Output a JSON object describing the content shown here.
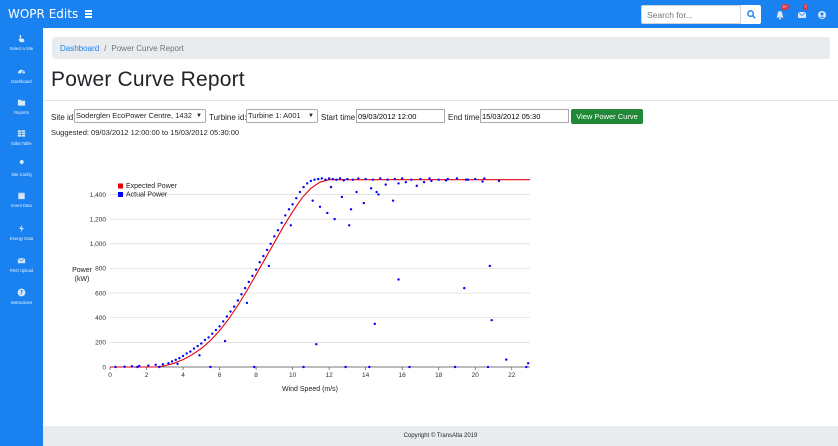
{
  "app": {
    "title": "WOPR Edits"
  },
  "topbar": {
    "search_placeholder": "Search for...",
    "alerts_badge": "9+",
    "messages_badge": "7"
  },
  "sidebar": {
    "items": [
      {
        "label": "Select a Site",
        "icon": "hand-pointer-icon"
      },
      {
        "label": "Dashboard",
        "icon": "gauge-icon"
      },
      {
        "label": "Reports",
        "icon": "folder-icon"
      },
      {
        "label": "Edits Table",
        "icon": "table-icon"
      },
      {
        "label": "Site Config",
        "icon": "wrench-icon"
      },
      {
        "label": "Event Data",
        "icon": "calendar-icon"
      },
      {
        "label": "Energy Data",
        "icon": "bolt-icon"
      },
      {
        "label": "RSO Upload",
        "icon": "envelope-icon"
      },
      {
        "label": "Instructions",
        "icon": "question-icon"
      }
    ]
  },
  "breadcrumb": {
    "home": "Dashboard",
    "separator": "/",
    "current": "Power Curve Report"
  },
  "page": {
    "title": "Power Curve Report"
  },
  "form": {
    "site_label": "Site id:",
    "site_value": "Soderglen EcoPower Centre, 1432",
    "turbine_label": "Turbine id:",
    "turbine_value": "Turbine 1: A001",
    "start_label": "Start time:",
    "start_value": "09/03/2012 12:00",
    "end_label": "End time:",
    "end_value": "15/03/2012 05:30",
    "submit_label": "View Power Curve",
    "suggested": "Suggested: 09/03/2012 12:00:00 to 15/03/2012 05:30:00"
  },
  "footer": {
    "copyright": "Copyright © TransAlta 2019"
  },
  "colors": {
    "primary": "#1a82f0",
    "expected": "#e8000b",
    "actual": "#0000ff",
    "success": "#218838"
  },
  "chart_data": {
    "type": "scatter",
    "title": "",
    "xlabel": "Wind Speed (m/s)",
    "ylabel": "Power\n(kW)",
    "xlim": [
      0,
      23
    ],
    "ylim": [
      0,
      1550
    ],
    "x_ticks": [
      0,
      2,
      4,
      6,
      8,
      10,
      12,
      14,
      16,
      18,
      20,
      22
    ],
    "y_ticks": [
      0,
      200,
      400,
      600,
      800,
      1000,
      1200,
      1400
    ],
    "y_tick_labels": [
      "0",
      "200",
      "400",
      "600",
      "800",
      "1,000",
      "1,200",
      "1,400"
    ],
    "legend": {
      "placement": "top-left",
      "entries": [
        "Expected Power",
        "Actual Power"
      ]
    },
    "series": [
      {
        "name": "Expected Power",
        "kind": "line",
        "x": [
          0,
          2.5,
          3,
          3.5,
          4,
          4.5,
          5,
          5.5,
          6,
          6.5,
          7,
          7.5,
          8,
          8.5,
          9,
          9.5,
          10,
          10.5,
          11,
          11.5,
          12,
          12.5,
          13,
          23
        ],
        "y": [
          0,
          0,
          10,
          30,
          60,
          100,
          150,
          215,
          295,
          390,
          500,
          620,
          750,
          880,
          1010,
          1140,
          1260,
          1370,
          1450,
          1500,
          1520,
          1520,
          1520,
          1520
        ]
      },
      {
        "name": "Actual Power",
        "kind": "scatter",
        "x": [
          0.3,
          0.8,
          1.2,
          1.6,
          2.1,
          2.5,
          2.9,
          3.2,
          3.4,
          3.6,
          3.8,
          4.0,
          4.2,
          4.4,
          4.6,
          4.8,
          5.0,
          5.2,
          5.4,
          5.6,
          5.8,
          6.0,
          6.2,
          6.4,
          6.6,
          6.8,
          7.0,
          7.2,
          7.4,
          7.6,
          7.8,
          8.0,
          8.2,
          8.4,
          8.6,
          8.8,
          9.0,
          9.2,
          9.4,
          9.6,
          9.8,
          10.0,
          10.2,
          10.4,
          10.6,
          10.8,
          11.0,
          11.2,
          11.4,
          11.6,
          11.8,
          12.0,
          12.2,
          12.4,
          12.6,
          12.8,
          13.0,
          13.3,
          13.6,
          14.0,
          14.4,
          14.8,
          15.2,
          15.6,
          16.0,
          16.5,
          17.0,
          17.5,
          18.0,
          18.5,
          19.0,
          19.5,
          20.0,
          20.5,
          11.5,
          11.9,
          12.3,
          12.7,
          13.1,
          13.5,
          13.9,
          14.3,
          14.7,
          15.1,
          15.5,
          16.2,
          16.8,
          17.6,
          3.7,
          4.9,
          6.3,
          7.5,
          8.7,
          9.9,
          11.1,
          12.1,
          13.2,
          14.6,
          15.8,
          17.2,
          18.4,
          19.6,
          20.4,
          21.3,
          1.5,
          2.7,
          5.5,
          7.9,
          10.6,
          12.9,
          14.2,
          16.4,
          18.9,
          20.7,
          22.8,
          19.4,
          20.8,
          20.9,
          14.5,
          15.8,
          11.3,
          21.7,
          22.9
        ],
        "y": [
          0,
          2,
          5,
          8,
          12,
          18,
          22,
          30,
          45,
          58,
          72,
          90,
          110,
          125,
          150,
          170,
          190,
          220,
          240,
          270,
          300,
          330,
          370,
          410,
          450,
          490,
          540,
          590,
          640,
          690,
          740,
          790,
          850,
          900,
          950,
          1000,
          1060,
          1110,
          1170,
          1230,
          1280,
          1320,
          1370,
          1420,
          1460,
          1490,
          1510,
          1520,
          1525,
          1530,
          1520,
          1530,
          1525,
          1520,
          1530,
          1515,
          1525,
          1520,
          1530,
          1525,
          1520,
          1530,
          1520,
          1525,
          1530,
          1520,
          1525,
          1530,
          1520,
          1525,
          1530,
          1520,
          1525,
          1530,
          1300,
          1250,
          1200,
          1380,
          1150,
          1420,
          1330,
          1450,
          1400,
          1480,
          1350,
          1500,
          1470,
          1510,
          25,
          95,
          210,
          520,
          820,
          1150,
          1350,
          1460,
          1280,
          1420,
          1490,
          1500,
          1515,
          1520,
          1505,
          1510,
          0,
          0,
          0,
          0,
          0,
          0,
          0,
          0,
          0,
          0,
          0,
          640,
          820,
          380,
          350,
          710,
          185,
          60,
          30
        ]
      }
    ]
  }
}
